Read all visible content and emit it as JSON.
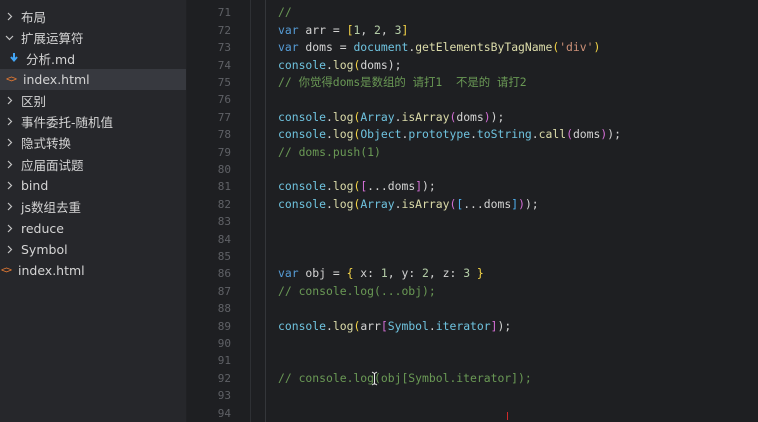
{
  "sidebar": {
    "items": [
      {
        "label": "布局",
        "type": "folder",
        "expanded": false
      },
      {
        "label": "扩展运算符",
        "type": "folder",
        "expanded": true
      },
      {
        "label": "分析.md",
        "type": "md-file"
      },
      {
        "label": "index.html",
        "type": "html-file",
        "selected": true
      },
      {
        "label": "区别",
        "type": "folder",
        "expanded": false
      },
      {
        "label": "事件委托-随机值",
        "type": "folder",
        "expanded": false
      },
      {
        "label": "隐式转换",
        "type": "folder",
        "expanded": false
      },
      {
        "label": "应届面试题",
        "type": "folder",
        "expanded": false
      },
      {
        "label": "bind",
        "type": "folder",
        "expanded": false
      },
      {
        "label": "js数组去重",
        "type": "folder",
        "expanded": false
      },
      {
        "label": "reduce",
        "type": "folder",
        "expanded": false
      },
      {
        "label": "Symbol",
        "type": "folder",
        "expanded": false
      },
      {
        "label": "index.html",
        "type": "html-file"
      }
    ]
  },
  "editor": {
    "line_numbers": [
      "71",
      "72",
      "73",
      "74",
      "75",
      "76",
      "77",
      "78",
      "79",
      "80",
      "81",
      "82",
      "83",
      "84",
      "85",
      "86",
      "87",
      "88",
      "89",
      "90",
      "91",
      "92",
      "93",
      "94"
    ],
    "lines": {
      "l71": "//",
      "l72": {
        "kw": "var",
        "name": " arr ",
        "eq": "= ",
        "open": "[",
        "n1": "1",
        "c1": ", ",
        "n2": "2",
        "c2": ", ",
        "n3": "3",
        "close": "]"
      },
      "l73": {
        "kw": "var",
        "name": " doms ",
        "eq": "= ",
        "obj": "document",
        "dot": ".",
        "fn": "getElementsByTagName",
        "open": "(",
        "str": "'div'",
        "close": ")"
      },
      "l74": {
        "obj": "console",
        "dot": ".",
        "fn": "log",
        "open": "(",
        "arg": "doms",
        "close": ");"
      },
      "l75": "// 你觉得doms是数组的 请打1  不是的 请打2",
      "l77": {
        "obj": "console",
        "dot": ".",
        "fn": "log",
        "open": "(",
        "cls": "Array",
        "dot2": ".",
        "fn2": "isArray",
        "open2": "(",
        "arg": "doms",
        "close2": ")",
        "close": ");"
      },
      "l78": {
        "obj": "console",
        "dot": ".",
        "fn": "log",
        "open": "(",
        "cls": "Object",
        "dot2": ".",
        "p1": "prototype",
        "dot3": ".",
        "p2": "toString",
        "dot4": ".",
        "fn2": "call",
        "open2": "(",
        "arg": "doms",
        "close2": ")",
        "close": ");"
      },
      "l79": "// doms.push(1)",
      "l81": {
        "obj": "console",
        "dot": ".",
        "fn": "log",
        "open": "(",
        "open2": "[",
        "arg": "...doms",
        "close2": "]",
        "close": ");"
      },
      "l82": {
        "obj": "console",
        "dot": ".",
        "fn": "log",
        "open": "(",
        "cls": "Array",
        "dot2": ".",
        "fn2": "isArray",
        "open2": "(",
        "open3": "[",
        "arg": "...doms",
        "close3": "]",
        "close2": ")",
        "close": ");"
      },
      "l86": {
        "kw": "var",
        "name": " obj ",
        "eq": "= ",
        "open": "{",
        "k1": " x",
        "c1": ": ",
        "n1": "1",
        "s1": ", ",
        "k2": "y",
        "c2": ": ",
        "n2": "2",
        "s2": ", ",
        "k3": "z",
        "c3": ": ",
        "n3": "3",
        "close": " }"
      },
      "l87": "// console.log(...obj);",
      "l89": {
        "obj": "console",
        "dot": ".",
        "fn": "log",
        "open": "(",
        "arg": "arr",
        "open2": "[",
        "cls": "Symbol",
        "dot2": ".",
        "p1": "iterator",
        "close2": "]",
        "close": ");"
      },
      "l92": "// console.log(obj[Symbol.iterator]);"
    }
  }
}
